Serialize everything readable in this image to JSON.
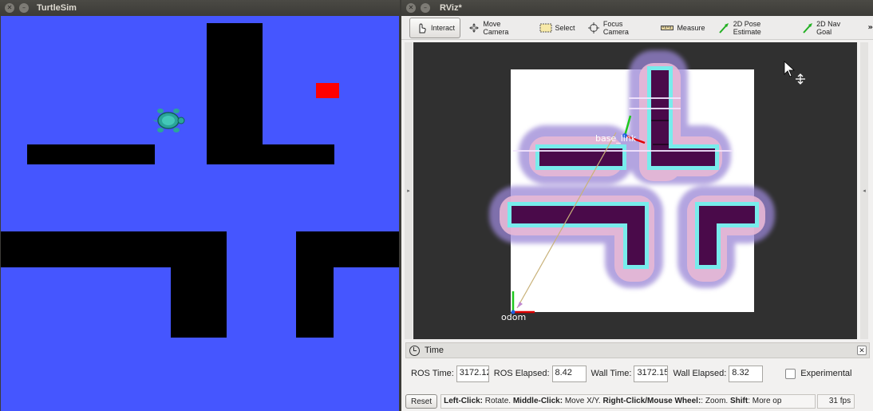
{
  "turtlesim": {
    "title": "TurtleSim"
  },
  "rviz": {
    "title": "RViz*",
    "toolbar": {
      "interact": "Interact",
      "move_camera": "Move Camera",
      "select": "Select",
      "focus_camera": "Focus Camera",
      "measure": "Measure",
      "pose_estimate": "2D Pose Estimate",
      "nav_goal": "2D Nav Goal",
      "more": "»"
    },
    "viewport": {
      "base_link_label": "base_link",
      "odom_label": "odom"
    },
    "time_panel": {
      "title": "Time",
      "ros_time_label": "ROS Time:",
      "ros_time_value": "3172.12",
      "ros_elapsed_label": "ROS Elapsed:",
      "ros_elapsed_value": "8.42",
      "wall_time_label": "Wall Time:",
      "wall_time_value": "3172.15",
      "wall_elapsed_label": "Wall Elapsed:",
      "wall_elapsed_value": "8.32",
      "experimental_label": "Experimental"
    },
    "status": {
      "reset_label": "Reset",
      "left_click": "Left-Click:",
      "left_click_desc": " Rotate. ",
      "middle_click": "Middle-Click:",
      "middle_click_desc": " Move X/Y. ",
      "right_click": "Right-Click/Mouse Wheel:",
      "right_click_desc": ": Zoom. ",
      "shift": "Shift",
      "shift_desc": ": More op",
      "fps": "31 fps"
    }
  },
  "colors": {
    "turtlesim_bg": "#4556ff",
    "goal": "#ff0000",
    "obstacle": "#000000"
  }
}
